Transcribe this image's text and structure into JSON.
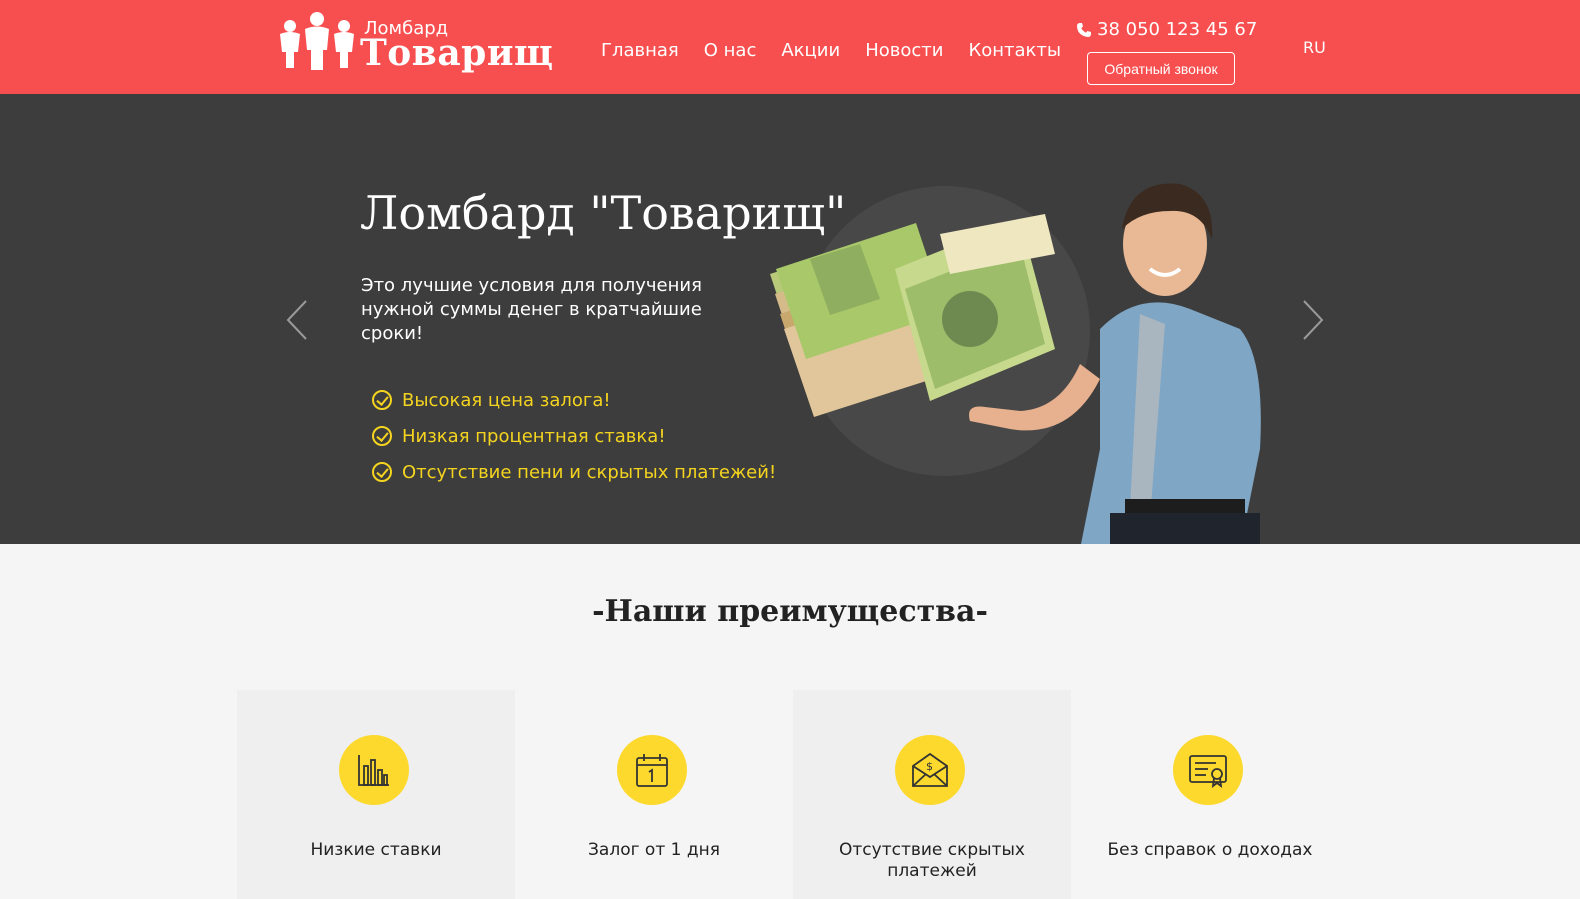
{
  "header": {
    "logo_small": "Ломбард",
    "logo_big": "Товарищ",
    "nav": [
      "Главная",
      "О нас",
      "Акции",
      "Новости",
      "Контакты"
    ],
    "phone": "38 050 123 45 67",
    "callback_label": "Обратный звонок",
    "lang": "RU"
  },
  "hero": {
    "title": "Ломбард \"Товарищ\"",
    "subtitle": "Это лучшие условия для получения нужной суммы денег в кратчайшие сроки!",
    "benefits": [
      "Высокая цена залога!",
      "Низкая процентная ставка!",
      "Отсутствие пени и скрытых платежей!"
    ]
  },
  "advantages": {
    "title": "-Наши преимущества-",
    "items": [
      {
        "label": "Низкие ставки",
        "icon": "bar-chart-icon"
      },
      {
        "label": "Залог от 1 дня",
        "icon": "calendar-icon"
      },
      {
        "label": "Отсутствие скрытых платежей",
        "icon": "money-envelope-icon"
      },
      {
        "label": "Без справок о доходах",
        "icon": "certificate-icon"
      }
    ]
  },
  "colors": {
    "header_bg": "#f74f4f",
    "hero_bg": "#3d3d3d",
    "accent_yellow": "#fcd92c"
  }
}
